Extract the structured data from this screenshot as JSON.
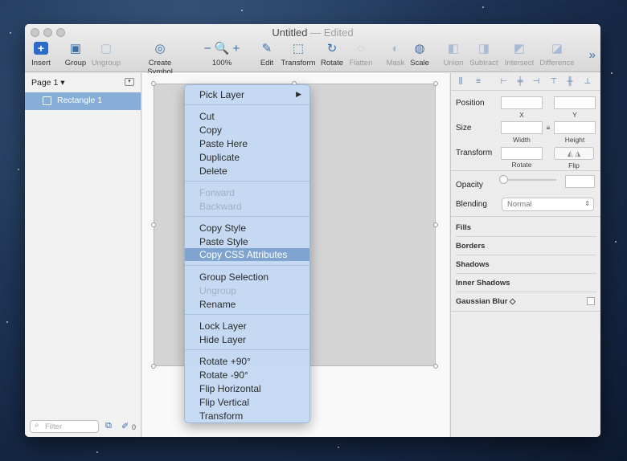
{
  "window": {
    "title": "Untitled",
    "edited": "— Edited"
  },
  "toolbar": {
    "items": [
      {
        "label": "Insert",
        "icon": "+"
      },
      {
        "label": "Group",
        "icon": "▣"
      },
      {
        "label": "Ungroup",
        "icon": "▢"
      },
      {
        "label": "Create Symbol",
        "icon": "◎"
      },
      {
        "label": "100%",
        "icon": "− 🔍 +"
      },
      {
        "label": "Edit",
        "icon": "✎"
      },
      {
        "label": "Transform",
        "icon": "⬚"
      },
      {
        "label": "Rotate",
        "icon": "↻"
      },
      {
        "label": "Flatten",
        "icon": "◌"
      },
      {
        "label": "Mask",
        "icon": "◐"
      },
      {
        "label": "Scale",
        "icon": "◍"
      },
      {
        "label": "Union",
        "icon": "◧"
      },
      {
        "label": "Subtract",
        "icon": "◨"
      },
      {
        "label": "Intersect",
        "icon": "◩"
      },
      {
        "label": "Difference",
        "icon": "◪"
      }
    ],
    "more": "»"
  },
  "layers": {
    "page": "Page 1 ▾",
    "layer": "Rectangle 1",
    "filter_placeholder": "Filter",
    "count": "0"
  },
  "menu": {
    "pick_layer": "Pick Layer",
    "cut": "Cut",
    "copy": "Copy",
    "paste_here": "Paste Here",
    "duplicate": "Duplicate",
    "delete": "Delete",
    "forward": "Forward",
    "backward": "Backward",
    "copy_style": "Copy Style",
    "paste_style": "Paste Style",
    "copy_css": "Copy CSS Attributes",
    "group_selection": "Group Selection",
    "ungroup": "Ungroup",
    "rename": "Rename",
    "lock_layer": "Lock Layer",
    "hide_layer": "Hide Layer",
    "rotate_cw": "Rotate +90°",
    "rotate_ccw": "Rotate -90°",
    "flip_h": "Flip Horizontal",
    "flip_v": "Flip Vertical",
    "transform": "Transform"
  },
  "inspector": {
    "position": "Position",
    "x": "X",
    "y": "Y",
    "size": "Size",
    "width": "Width",
    "height": "Height",
    "transform": "Transform",
    "rotate": "Rotate",
    "flip": "Flip",
    "opacity": "Opacity",
    "blending": "Blending",
    "blending_value": "Normal",
    "fills": "Fills",
    "borders": "Borders",
    "shadows": "Shadows",
    "inner_shadows": "Inner Shadows",
    "gaussian_blur": "Gaussian Blur ◇"
  }
}
